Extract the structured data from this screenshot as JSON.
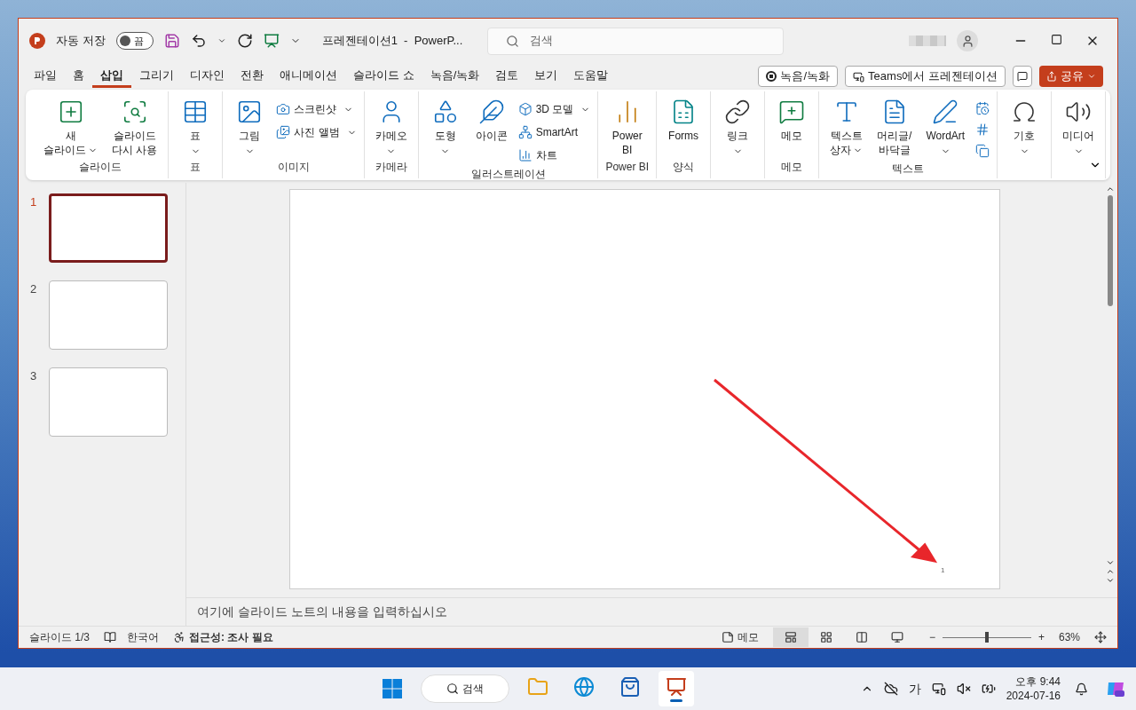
{
  "title_bar": {
    "autosave_label": "자동 저장",
    "autosave_toggle": {
      "label": "끔",
      "on": false
    },
    "title": "프레젠테이션1  -  PowerP...",
    "search_placeholder": "검색"
  },
  "menu_tabs": [
    {
      "label": "파일",
      "selected": false
    },
    {
      "label": "홈",
      "selected": false
    },
    {
      "label": "삽입",
      "selected": true
    },
    {
      "label": "그리기",
      "selected": false
    },
    {
      "label": "디자인",
      "selected": false
    },
    {
      "label": "전환",
      "selected": false
    },
    {
      "label": "애니메이션",
      "selected": false
    },
    {
      "label": "슬라이드 쇼",
      "selected": false
    },
    {
      "label": "녹음/녹화",
      "selected": false
    },
    {
      "label": "검토",
      "selected": false
    },
    {
      "label": "보기",
      "selected": false
    },
    {
      "label": "도움말",
      "selected": false
    }
  ],
  "header_buttons": {
    "record": "녹음/녹화",
    "teams": "Teams에서 프레젠테이션",
    "share": "공유"
  },
  "ribbon_groups": [
    {
      "label": "슬라이드",
      "items": [
        {
          "kind": "large",
          "lines": [
            "새",
            "슬라이드"
          ],
          "dropdown": true
        },
        {
          "kind": "large",
          "lines": [
            "슬라이드",
            "다시 사용"
          ],
          "dropdown": false
        }
      ]
    },
    {
      "label": "표",
      "items": [
        {
          "kind": "large",
          "lines": [
            "표"
          ],
          "dropdown": true
        }
      ]
    },
    {
      "label": "이미지",
      "items": [
        {
          "kind": "large",
          "lines": [
            "그림"
          ],
          "dropdown": true
        },
        {
          "kind": "small",
          "lines": [
            "스크린샷"
          ],
          "dropdown": true
        },
        {
          "kind": "small",
          "lines": [
            "사진 앨범"
          ],
          "dropdown": true
        }
      ]
    },
    {
      "label": "카메라",
      "items": [
        {
          "kind": "large",
          "lines": [
            "카메오"
          ],
          "dropdown": true
        }
      ]
    },
    {
      "label": "일러스트레이션",
      "items": [
        {
          "kind": "large",
          "lines": [
            "도형"
          ],
          "dropdown": true
        },
        {
          "kind": "large",
          "lines": [
            "아이콘"
          ],
          "dropdown": false
        },
        {
          "kind": "small",
          "lines": [
            "3D 모델"
          ],
          "dropdown": true
        },
        {
          "kind": "small",
          "lines": [
            "SmartArt"
          ],
          "dropdown": false
        },
        {
          "kind": "small",
          "lines": [
            "차트"
          ],
          "dropdown": false
        }
      ]
    },
    {
      "label": "Power BI",
      "items": [
        {
          "kind": "large",
          "lines": [
            "Power",
            "BI"
          ],
          "dropdown": false
        }
      ]
    },
    {
      "label": "양식",
      "items": [
        {
          "kind": "large",
          "lines": [
            "Forms"
          ],
          "dropdown": false
        }
      ]
    },
    {
      "items": [
        {
          "kind": "large",
          "lines": [
            "링크"
          ],
          "dropdown": true
        }
      ]
    },
    {
      "label": "메모",
      "items": [
        {
          "kind": "large",
          "lines": [
            "메모"
          ],
          "dropdown": false
        }
      ]
    },
    {
      "label": "텍스트",
      "items": [
        {
          "kind": "large",
          "lines": [
            "텍스트",
            "상자"
          ],
          "dropdown": true
        },
        {
          "kind": "large",
          "lines": [
            "머리글/",
            "바닥글"
          ],
          "dropdown": false
        },
        {
          "kind": "large",
          "lines": [
            "WordArt"
          ],
          "dropdown": true
        },
        {
          "kind": "icon"
        },
        {
          "kind": "icon"
        },
        {
          "kind": "icon"
        }
      ]
    },
    {
      "items": [
        {
          "kind": "large",
          "lines": [
            "기호"
          ],
          "dropdown": true
        }
      ]
    },
    {
      "items": [
        {
          "kind": "large",
          "lines": [
            "미디어"
          ],
          "dropdown": true
        }
      ]
    }
  ],
  "slides": [
    {
      "number": "1",
      "selected": true
    },
    {
      "number": "2",
      "selected": false
    },
    {
      "number": "3",
      "selected": false
    }
  ],
  "slide": {
    "page_number": "1"
  },
  "notes_placeholder": "여기에 슬라이드 노트의 내용을 입력하십시오",
  "status_bar": {
    "slide_count": "슬라이드 1/3",
    "language": "한국어",
    "accessibility": "접근성: 조사 필요",
    "notes": "메모",
    "views": [
      {
        "selected": true
      },
      {
        "selected": false
      },
      {
        "selected": false
      },
      {
        "selected": false
      }
    ],
    "zoom_out": "−",
    "zoom_in": "+",
    "zoom": {
      "level": 0.5
    },
    "zoom_reading": "63%"
  },
  "taskbar": {
    "search": "검색",
    "apps": [
      {
        "selected": false
      },
      {
        "selected": false
      },
      {
        "selected": false
      },
      {
        "selected": true
      }
    ],
    "ime": "가",
    "time": "오후 9:44",
    "date": "2024-07-16"
  }
}
